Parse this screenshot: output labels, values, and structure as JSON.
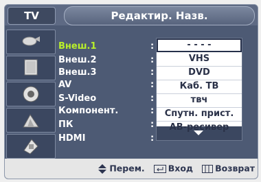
{
  "header": {
    "source_tab": "TV",
    "title": "Редактир. Назв."
  },
  "sidebar": {
    "icons": [
      {
        "name": "satellite-dish-icon"
      },
      {
        "name": "monitor-icon"
      },
      {
        "name": "speaker-icon"
      },
      {
        "name": "channel-antenna-icon"
      },
      {
        "name": "settings-icon"
      }
    ]
  },
  "inputs": [
    {
      "label": "Внеш.1",
      "value": "- - - -",
      "active": true
    },
    {
      "label": "Внеш.2",
      "value": ""
    },
    {
      "label": "Внеш.3",
      "value": ""
    },
    {
      "label": "AV",
      "value": ""
    },
    {
      "label": "S-Video",
      "value": ""
    },
    {
      "label": "Компонент.",
      "value": ""
    },
    {
      "label": "ПК",
      "value": ""
    },
    {
      "label": "HDMI",
      "value": "- - - -"
    }
  ],
  "dropdown": {
    "options": [
      "- - - -",
      "VHS",
      "DVD",
      "Каб. ТВ",
      "твч",
      "Спутн. прист.",
      "АВ-ресивер"
    ],
    "selected_index": 0
  },
  "footer": {
    "move_label": "Перем.",
    "enter_label": "Вход",
    "return_label": "Возврат"
  },
  "colors": {
    "accent": "#b9f02a",
    "panel": "#4d5a74"
  }
}
